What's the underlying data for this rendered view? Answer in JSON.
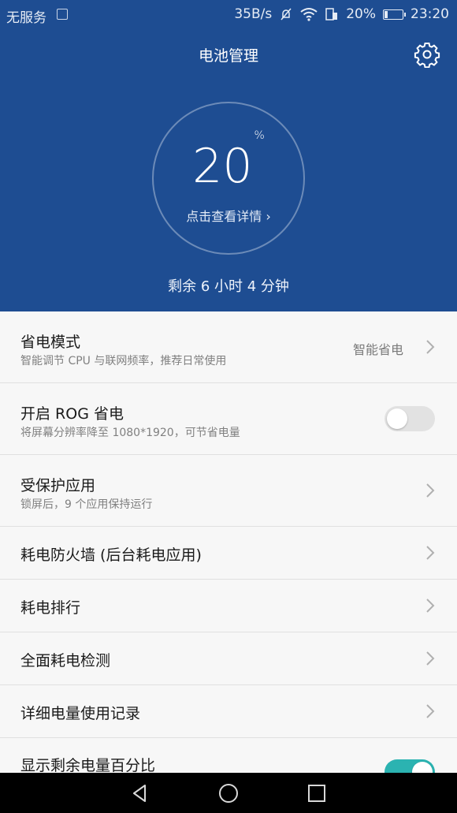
{
  "status_bar": {
    "carrier": "无服务",
    "speed": "35B/s",
    "battery_percent": "20%",
    "time": "23:20",
    "icons": [
      "sim-card-icon",
      "silent-icon",
      "wifi-icon",
      "battery-saver-icon",
      "battery-icon"
    ]
  },
  "header": {
    "title": "电池管理",
    "percent_value": "20",
    "percent_unit": "%",
    "details_link": "点击查看详情 ›",
    "remaining": "剩余 6 小时 4 分钟",
    "settings_icon": "gear-icon"
  },
  "settings": [
    {
      "title": "省电模式",
      "subtitle": "智能调节 CPU 与联网频率，推荐日常使用",
      "value": "智能省电",
      "control": "chevron"
    },
    {
      "title": "开启 ROG 省电",
      "subtitle": "将屏幕分辨率降至 1080*1920，可节省电量",
      "control": "toggle",
      "on": false
    },
    {
      "title": "受保护应用",
      "subtitle": "锁屏后，9 个应用保持运行",
      "control": "chevron"
    },
    {
      "title": "耗电防火墙 (后台耗电应用)",
      "control": "chevron"
    },
    {
      "title": "耗电排行",
      "control": "chevron"
    },
    {
      "title": "全面耗电检测",
      "control": "chevron"
    },
    {
      "title": "详细电量使用记录",
      "control": "chevron"
    },
    {
      "title": "显示剩余电量百分比",
      "control": "toggle",
      "on": true
    }
  ],
  "nav_bar": {
    "icons": [
      "back-icon",
      "home-icon",
      "recents-icon"
    ]
  },
  "colors": {
    "header_bg": "#1e4d92",
    "toggle_on": "#2bb3b1",
    "toggle_off": "#e2e2e2"
  }
}
